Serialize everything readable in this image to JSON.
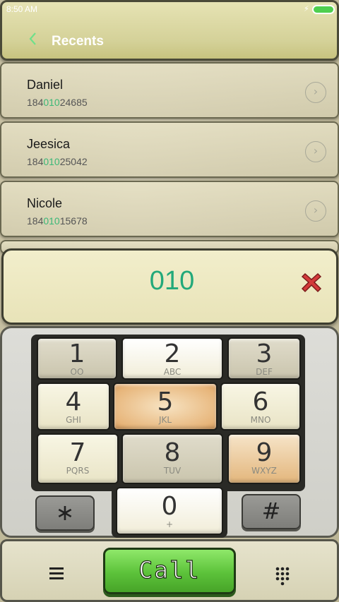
{
  "status_bar": {
    "time": "8:50 AM"
  },
  "header": {
    "title": "Recents"
  },
  "contacts": [
    {
      "name": "Daniel",
      "number_pre": "184",
      "number_match": "010",
      "number_post": "24685"
    },
    {
      "name": "Jeesica",
      "number_pre": "184",
      "number_match": "010",
      "number_post": "25042"
    },
    {
      "name": "Nicole",
      "number_pre": "184",
      "number_match": "010",
      "number_post": "15678"
    }
  ],
  "display": {
    "value": "010"
  },
  "keypad": {
    "keys": [
      {
        "digit": "1",
        "letters": "OO"
      },
      {
        "digit": "2",
        "letters": "ABC"
      },
      {
        "digit": "3",
        "letters": "DEF"
      },
      {
        "digit": "4",
        "letters": "GHI"
      },
      {
        "digit": "5",
        "letters": "JKL"
      },
      {
        "digit": "6",
        "letters": "MNO"
      },
      {
        "digit": "7",
        "letters": "PQRS"
      },
      {
        "digit": "8",
        "letters": "TUV"
      },
      {
        "digit": "9",
        "letters": "WXYZ"
      },
      {
        "digit": "0",
        "letters": "+"
      }
    ],
    "star": {
      "symbol": "∗",
      "sub": ","
    },
    "hash": {
      "symbol": "#",
      "sub": ""
    }
  },
  "bottom_bar": {
    "call_label": "Call"
  },
  "colors": {
    "accent": "#23a97a",
    "call_green": "#5cc23a",
    "battery": "#4fcf4f"
  }
}
